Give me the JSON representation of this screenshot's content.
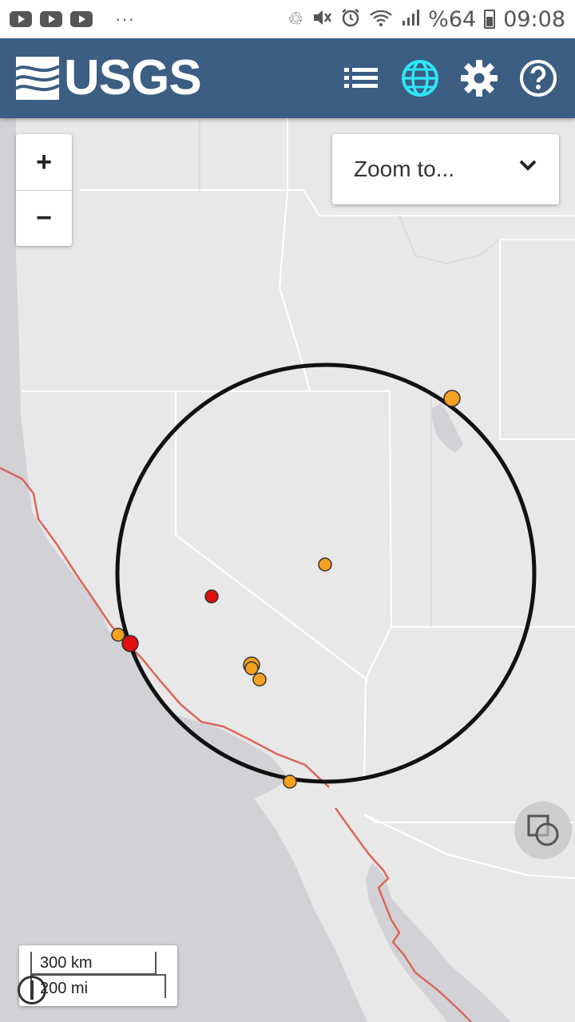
{
  "status_bar": {
    "battery_text": "%64",
    "time": "09:08",
    "overflow_text": "···"
  },
  "header": {
    "logo_text": "USGS",
    "icons": [
      "list-icon",
      "globe-icon",
      "gear-icon",
      "help-icon"
    ],
    "active_icon_color": "#2ee4f5",
    "background_color": "#3b5e82"
  },
  "map": {
    "zoom_in_label": "+",
    "zoom_out_label": "−",
    "zoom_to_placeholder": "Zoom to...",
    "scale": {
      "km_label": "300 km",
      "mi_label": "200 mi"
    },
    "marker_colors": {
      "orange": "#f5a020",
      "red": "#e01010"
    },
    "fault_color": "#d9665b"
  }
}
